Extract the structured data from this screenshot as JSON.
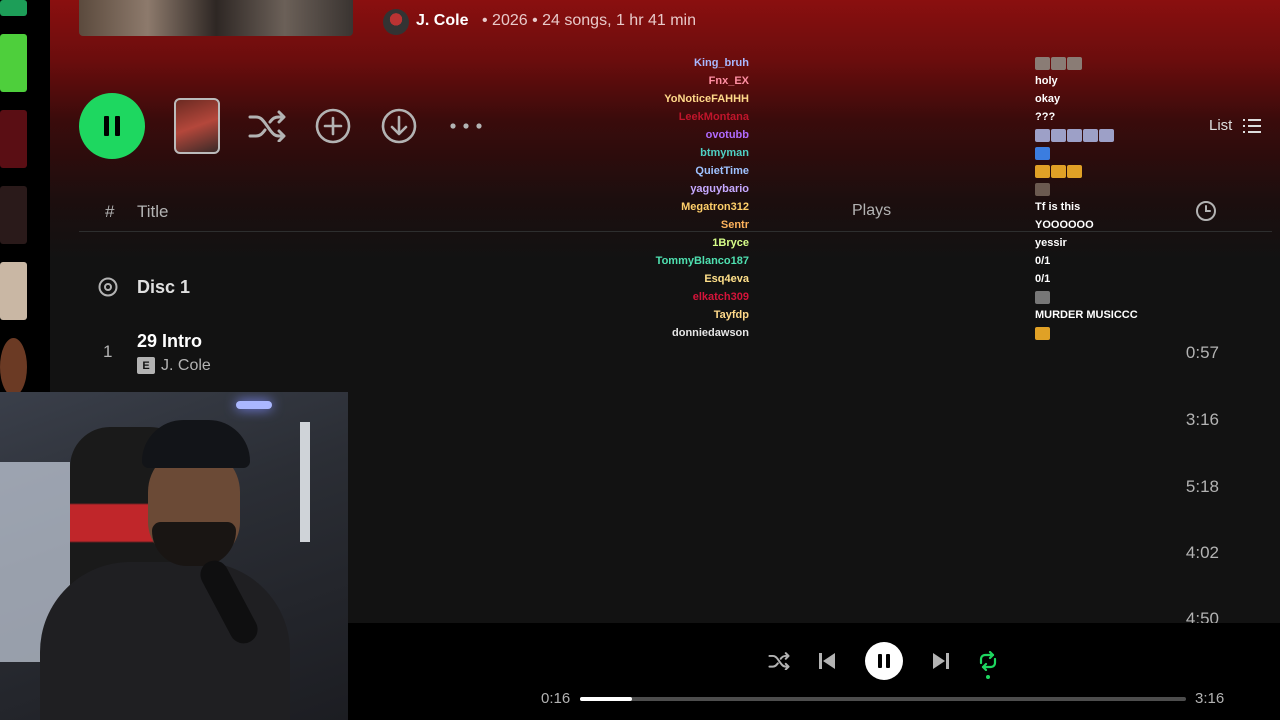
{
  "header": {
    "artist": "J. Cole",
    "meta": "• 2026 • 24 songs, 1 hr 41 min"
  },
  "actions": {
    "list_label": "List"
  },
  "table": {
    "col_num": "#",
    "col_title": "Title",
    "col_plays": "Plays",
    "disc_label": "Disc 1",
    "rows": [
      {
        "num": "1",
        "title": "29 Intro",
        "explicit": "E",
        "artist": "J. Cole",
        "duration": "0:57"
      },
      {
        "duration": "3:16"
      },
      {
        "duration": "5:18"
      },
      {
        "duration": "4:02"
      },
      {
        "duration": "4:50"
      }
    ]
  },
  "chat": [
    {
      "user": "King_bruh",
      "color": "#a9b8ff",
      "msg": "",
      "emotes": [
        "#8a7c75",
        "#8a7c75",
        "#8a7c75"
      ]
    },
    {
      "user": "Fnx_EX",
      "color": "#ff8fa3",
      "msg": "holy",
      "emotes": []
    },
    {
      "user": "YoNoticeFAHHH",
      "color": "#ffd98a",
      "msg": "okay",
      "emotes": []
    },
    {
      "user": "LeekMontana",
      "color": "#c0152b",
      "msg": "???",
      "emotes": []
    },
    {
      "user": "ovotubb",
      "color": "#b06bff",
      "msg": "",
      "emotes": [
        "#9da0c7",
        "#9da0c7",
        "#9da0c7",
        "#9da0c7",
        "#9da0c7"
      ]
    },
    {
      "user": "btmyman",
      "color": "#4fd0c4",
      "msg": "",
      "emotes": [
        "#3b7de0"
      ]
    },
    {
      "user": "QuietTime",
      "color": "#9ec2ff",
      "msg": "",
      "emotes": [
        "#e0a126",
        "#e0a126",
        "#e0a126"
      ]
    },
    {
      "user": "yaguybario",
      "color": "#c6a9ff",
      "msg": "",
      "emotes": [
        "#6b5a50"
      ]
    },
    {
      "user": "Megatron312",
      "color": "#ffcf6a",
      "msg": "Tf is this",
      "emotes": []
    },
    {
      "user": "Sentr",
      "color": "#ffb35c",
      "msg": "YOOOOOO",
      "emotes": []
    },
    {
      "user": "1Bryce",
      "color": "#d7ff8a",
      "msg": "yessir",
      "emotes": []
    },
    {
      "user": "TommyBlanco187",
      "color": "#4fe0b0",
      "msg": "0/1",
      "emotes": []
    },
    {
      "user": "Esq4eva",
      "color": "#ffe08a",
      "msg": "0/1",
      "emotes": []
    },
    {
      "user": "elkatch309",
      "color": "#d4143a",
      "msg": "",
      "emotes": [
        "#777777"
      ]
    },
    {
      "user": "Tayfdp",
      "color": "#ffd98a",
      "msg": "MURDER MUSICCC",
      "emotes": []
    },
    {
      "user": "donniedawson",
      "color": "#e6e6e6",
      "msg": "",
      "emotes": [
        "#e0a126"
      ]
    }
  ],
  "player": {
    "current_time": "0:16",
    "total_time": "3:16",
    "progress": 0.085,
    "state": "playing",
    "repeat_active": true
  },
  "colors": {
    "accent": "#1ed760",
    "header_gradient_top": "#8a0f0f",
    "background": "#121212"
  }
}
